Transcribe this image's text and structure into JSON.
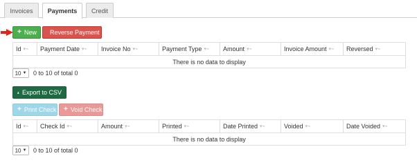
{
  "tabs": [
    {
      "label": "Invoices",
      "active": false
    },
    {
      "label": "Payments",
      "active": true
    },
    {
      "label": "Credit",
      "active": false
    }
  ],
  "colors": {
    "arrow": "#e32219",
    "new": "#4cae4c",
    "reverse": "#d9534f",
    "export": "#1e6b43",
    "print": "#9fd6e8",
    "void": "#e99a98"
  },
  "payments": {
    "new_label": "New",
    "new_icon": "plus-icon",
    "reverse_label": "Reverse Payment",
    "reverse_icon": "trash-icon",
    "columns": [
      "Id",
      "Payment Date",
      "Invoice No",
      "Payment Type",
      "Amount",
      "Invoice Amount",
      "Reversed"
    ],
    "empty_text": "There is no data to display",
    "page_size": "10",
    "page_info": "0 to 10 of total 0"
  },
  "checks": {
    "export_label": "Export to CSV",
    "export_icon": "user-export-icon",
    "print_label": "Print Check",
    "void_label": "Void Check",
    "columns": [
      "Id",
      "Check Id",
      "Amount",
      "Printed",
      "Date Printed",
      "Voided",
      "Date Voided"
    ],
    "empty_text": "There is no data to display",
    "page_size": "10",
    "page_info": "0 to 10 of total 0"
  }
}
